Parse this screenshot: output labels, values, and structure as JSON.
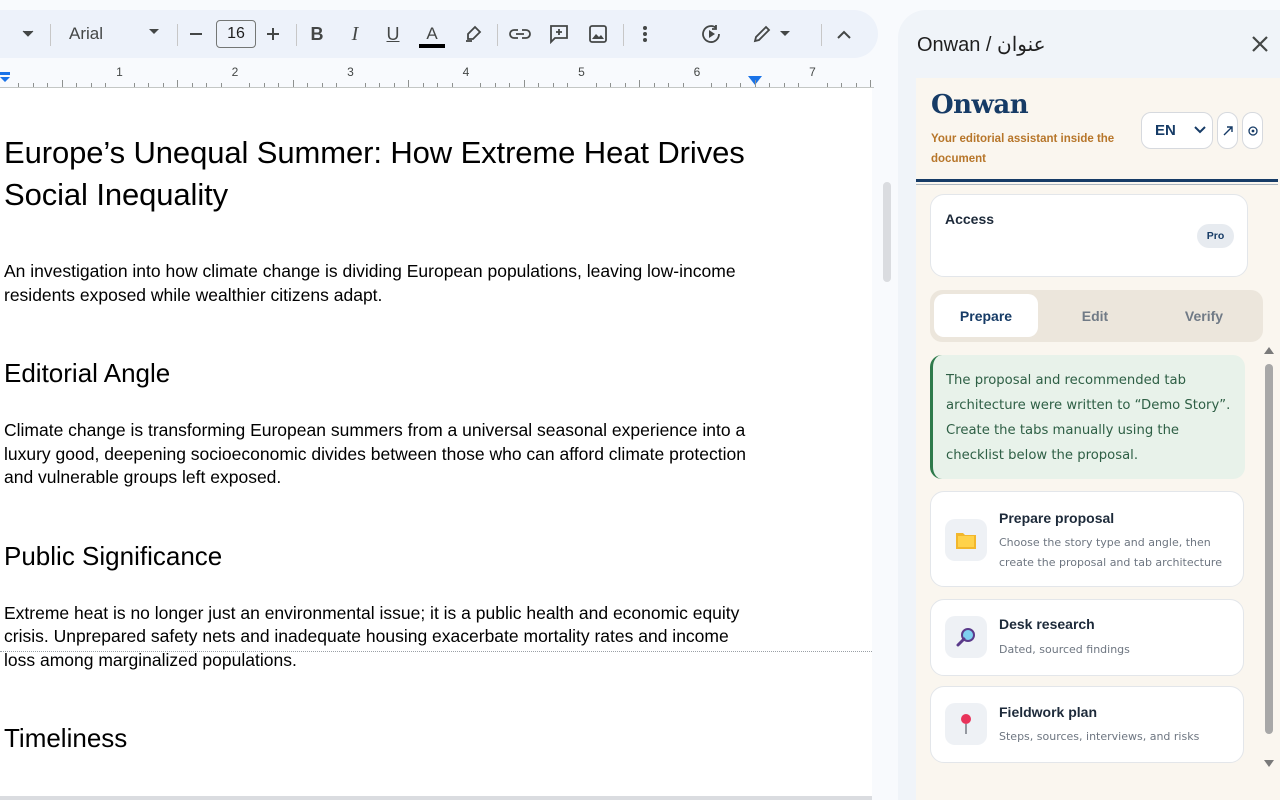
{
  "toolbar": {
    "font_family": "Arial",
    "font_size": "16",
    "bold_label": "B",
    "italic_label": "I",
    "underline_label": "U",
    "text_color_label": "A"
  },
  "ruler": {
    "numbers": [
      "1",
      "2",
      "3",
      "4",
      "5",
      "6",
      "7"
    ]
  },
  "document": {
    "title": "Europe’s Unequal Summer: How Extreme Heat Drives Social Inequality",
    "intro": "An investigation into how climate change is dividing European populations, leaving low-income residents exposed while wealthier citizens adapt.",
    "sections": [
      {
        "heading": "Editorial Angle",
        "body": "Climate change is transforming European summers from a universal seasonal experience into a luxury good, deepening socioeconomic divides between those who can afford climate protection and vulnerable groups left exposed."
      },
      {
        "heading": "Public Significance",
        "body": "Extreme heat is no longer just an environmental issue; it is a public health and economic equity crisis. Unprepared safety nets and inadequate housing exacerbate mortality rates and income loss among marginalized populations."
      },
      {
        "heading": "Timeliness",
        "body": ""
      }
    ]
  },
  "panel": {
    "title": "Onwan / عنوان",
    "brand": "Onwan",
    "tagline": "Your editorial assistant inside the document",
    "language": "EN",
    "access_label": "Access",
    "access_badge": "Pro",
    "tabs": [
      "Prepare",
      "Edit",
      "Verify"
    ],
    "active_tab": "Prepare",
    "notice": "The proposal and recommended tab architecture were written to “Demo Story”. Create the tabs manually using the checklist below the proposal.",
    "steps": [
      {
        "title": "Prepare proposal",
        "description": "Choose the story type and angle, then create the proposal and tab architecture",
        "icon": "folder-icon"
      },
      {
        "title": "Desk research",
        "description": "Dated, sourced findings",
        "icon": "magnifier-icon"
      },
      {
        "title": "Fieldwork plan",
        "description": "Steps, sources, interviews, and risks",
        "icon": "pushpin-icon"
      }
    ]
  },
  "colors": {
    "brand_navy": "#163b66",
    "tagline_amber": "#b7762a",
    "notice_green": "#2e7a4b",
    "panel_background": "#faf6ef"
  }
}
